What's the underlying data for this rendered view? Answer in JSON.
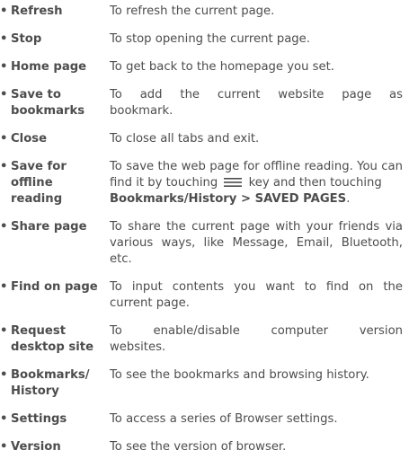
{
  "items": [
    {
      "term": "Refresh",
      "desc": "To refresh the current page."
    },
    {
      "term": "Stop",
      "desc": "To stop opening the current page."
    },
    {
      "term": "Home page",
      "desc": "To get back to the homepage you set."
    },
    {
      "term_lines": [
        "Save to",
        "bookmarks"
      ],
      "desc_lines": [
        "To add the current website page as",
        "bookmark."
      ]
    },
    {
      "term": "Close",
      "desc": "To close all tabs and exit."
    },
    {
      "term_lines": [
        "Save for",
        "offline",
        "reading"
      ],
      "desc_lines": [
        "To save the web page for offline reading. You can",
        "find it by touching",
        "key and then touching",
        "Bookmarks/History > SAVED PAGES",
        "."
      ]
    },
    {
      "term": "Share page",
      "desc_lines": [
        "To share the current page with your friends via",
        "various ways, like Message, Email, Bluetooth,",
        "etc."
      ]
    },
    {
      "term": "Find on page",
      "desc_lines": [
        "To input contents you want to find on the",
        "current page."
      ]
    },
    {
      "term_lines": [
        "Request",
        "desktop site"
      ],
      "desc_lines": [
        "To enable/disable computer version",
        "websites."
      ]
    },
    {
      "term_lines": [
        "Bookmarks/",
        "History"
      ],
      "desc": "To see the bookmarks and browsing history."
    },
    {
      "term": "Settings",
      "desc": "To access a series of Browser settings."
    },
    {
      "term": "Version",
      "desc": "To see the version of browser."
    }
  ],
  "bullet": "•",
  "menu_icon": "menu-icon"
}
